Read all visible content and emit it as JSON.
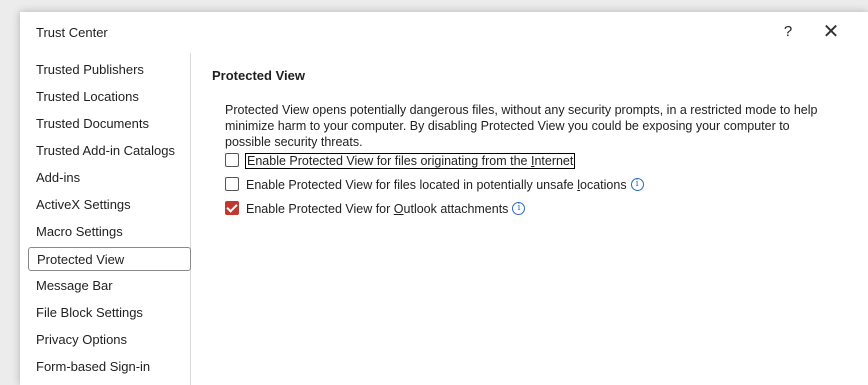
{
  "window": {
    "title": "Trust Center",
    "help_glyph": "?",
    "close_glyph": "✕"
  },
  "sidebar": {
    "items": [
      {
        "label": "Trusted Publishers",
        "selected": false
      },
      {
        "label": "Trusted Locations",
        "selected": false
      },
      {
        "label": "Trusted Documents",
        "selected": false
      },
      {
        "label": "Trusted Add-in Catalogs",
        "selected": false
      },
      {
        "label": "Add-ins",
        "selected": false
      },
      {
        "label": "ActiveX Settings",
        "selected": false
      },
      {
        "label": "Macro Settings",
        "selected": false
      },
      {
        "label": "Protected View",
        "selected": true
      },
      {
        "label": "Message Bar",
        "selected": false
      },
      {
        "label": "File Block Settings",
        "selected": false
      },
      {
        "label": "Privacy Options",
        "selected": false
      },
      {
        "label": "Form-based Sign-in",
        "selected": false
      }
    ]
  },
  "main": {
    "section_title": "Protected View",
    "description": "Protected View opens potentially dangerous files, without any security prompts, in a restricted mode to help minimize harm to your computer. By disabling Protected View you could be exposing your computer to possible security threats.",
    "options": [
      {
        "pre": "Enable Protected View for files originating from the ",
        "accel": "I",
        "post": "nternet",
        "checked": false,
        "info": false,
        "focused": true
      },
      {
        "pre": "Enable Protected View for files located in potentially unsafe ",
        "accel": "l",
        "post": "ocations",
        "checked": false,
        "info": true,
        "focused": false
      },
      {
        "pre": "Enable Protected View for ",
        "accel": "O",
        "post": "utlook attachments",
        "checked": true,
        "info": true,
        "focused": false
      }
    ],
    "info_icon": "info-icon",
    "checkbox_checked_color": "#c4372c"
  }
}
